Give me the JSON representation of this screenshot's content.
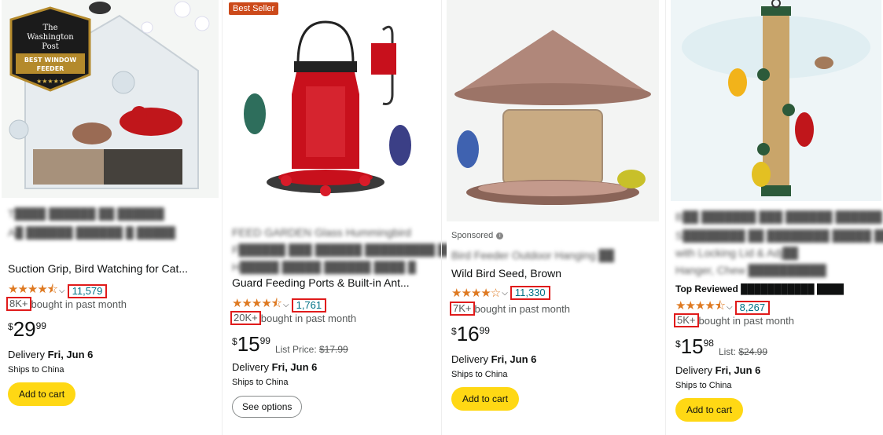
{
  "products": [
    {
      "badge": "",
      "sponsored": "",
      "title_lines": [
        "T████ ██████ ██ ██████",
        "A█ ██████ ██████ █ █████",
        "Suction Grip, Bird Watching for Cat..."
      ],
      "top_reviewed": "",
      "rating_count": "11,579",
      "bought_badge": "8K+",
      "bought_text": "bought in past month",
      "price": {
        "currency": "$",
        "whole": "29",
        "fraction": "99"
      },
      "list_label": "",
      "list_price": "",
      "delivery_label": "Delivery",
      "delivery_date": "Fri, Jun 6",
      "ships": "Ships to China",
      "button": "Add to cart",
      "logo_text": [
        "The",
        "Washington",
        "Post",
        "BEST WINDOW",
        "FEEDER"
      ]
    },
    {
      "badge": "Best Seller",
      "sponsored": "",
      "title_lines": [
        "FEED GARDEN Glass Hummingbird",
        "F██████ ███ ██████ █████████ ██ ██",
        "H█████ █████ ██████ ████ █",
        "Guard Feeding Ports & Built-in Ant..."
      ],
      "top_reviewed": "",
      "rating_count": "1,761",
      "bought_badge": "20K+",
      "bought_text": "bought in past month",
      "price": {
        "currency": "$",
        "whole": "15",
        "fraction": "99"
      },
      "list_label": "List Price:",
      "list_price": "$17.99",
      "delivery_label": "Delivery",
      "delivery_date": "Fri, Jun 6",
      "ships": "Ships to China",
      "button": "See options"
    },
    {
      "badge": "",
      "sponsored": "Sponsored",
      "title_lines": [
        "Bird Feeder Outdoor Hanging ██",
        "Wild Bird Seed, Brown"
      ],
      "top_reviewed": "",
      "rating_count": "11,330",
      "bought_badge": "7K+",
      "bought_text": "bought in past month",
      "price": {
        "currency": "$",
        "whole": "16",
        "fraction": "99"
      },
      "list_label": "",
      "list_price": "",
      "delivery_label": "Delivery",
      "delivery_date": "Fri, Jun 6",
      "ships": "Ships to China",
      "button": "Add to cart"
    },
    {
      "badge": "",
      "sponsored": "",
      "title_lines": [
        "B██ ███████ ███ ██████ ██████",
        "S████████ ██ ████████ █████ ████",
        "with Locking Lid & Adj██",
        "Hanger, Chew ██████████"
      ],
      "top_reviewed": "Top Reviewed ███████████ ████",
      "rating_count": "8,267",
      "bought_badge": "5K+",
      "bought_text": "bought in past month",
      "price": {
        "currency": "$",
        "whole": "15",
        "fraction": "98"
      },
      "list_label": "List:",
      "list_price": "$24.99",
      "delivery_label": "Delivery",
      "delivery_date": "Fri, Jun 6",
      "ships": "Ships to China",
      "button": "Add to cart"
    }
  ],
  "stars": {
    "p0": "★★★★⯪",
    "p1": "★★★★⯪",
    "p2": "★★★★☆",
    "p3": "★★★★⯪"
  },
  "colors": {
    "star": "#de7921",
    "link": "#007185",
    "cart_button": "#ffd814",
    "highlight": "#e01b1b",
    "best_seller": "#cc4a1b"
  }
}
